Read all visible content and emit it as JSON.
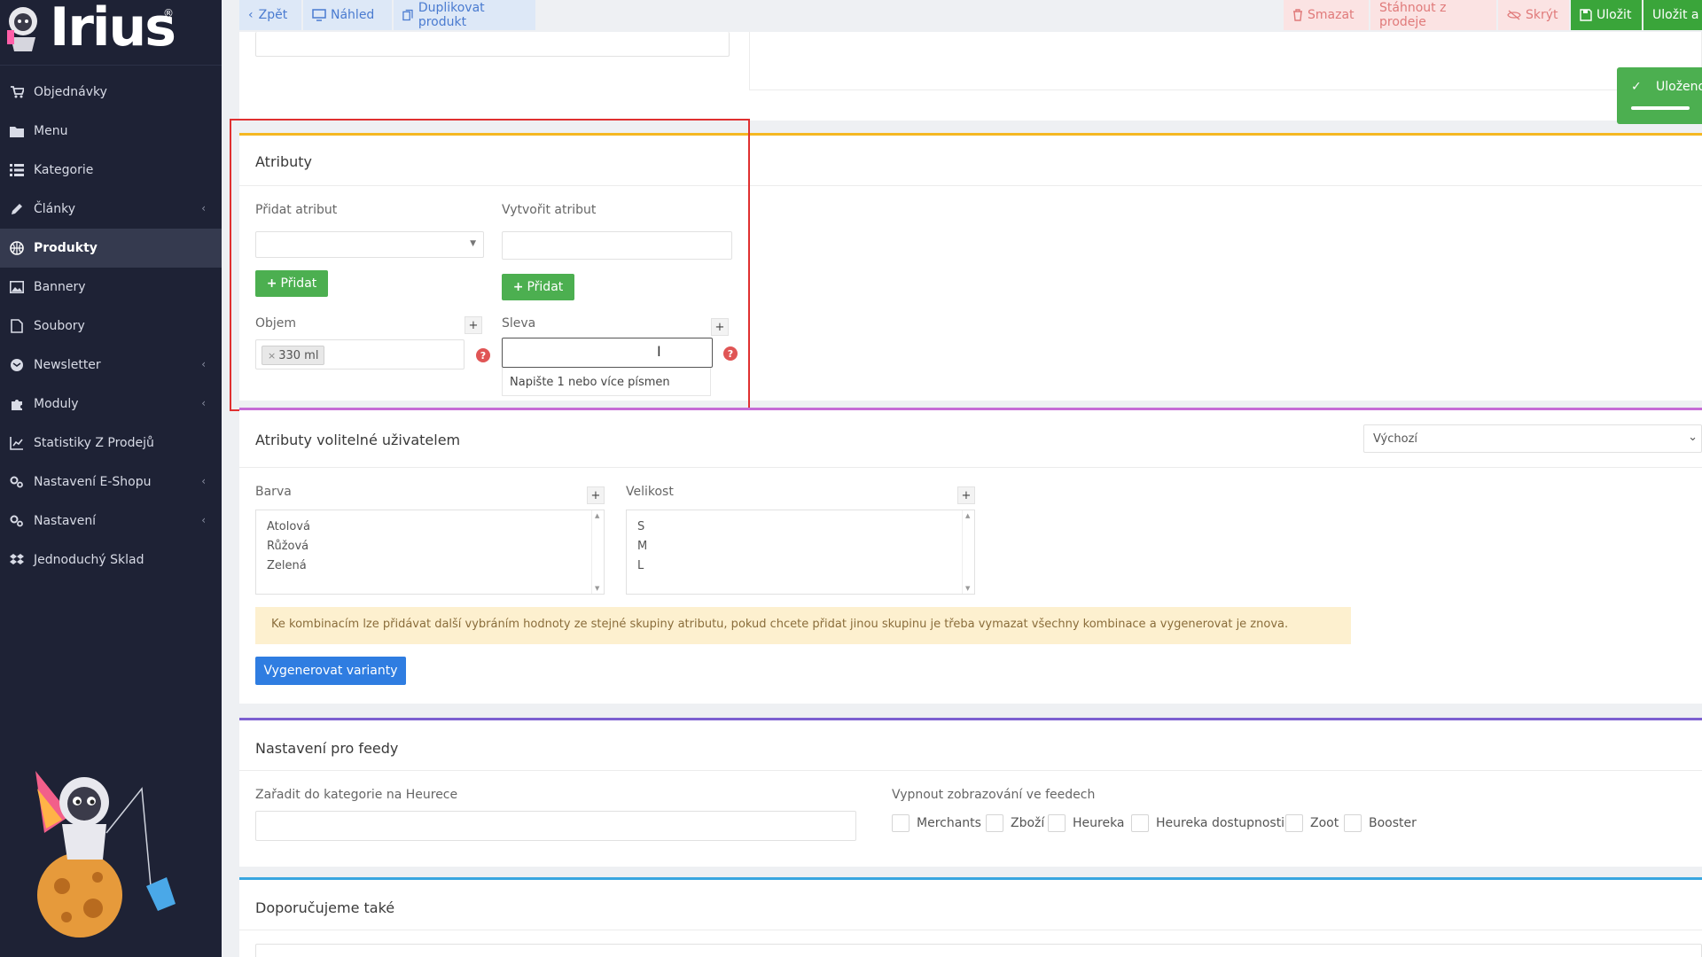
{
  "sidebar": {
    "brand": "Irius",
    "brand_mark": "®",
    "items": [
      {
        "label": "Objednávky",
        "icon": "cart-icon"
      },
      {
        "label": "Menu",
        "icon": "folder-icon"
      },
      {
        "label": "Kategorie",
        "icon": "list-icon"
      },
      {
        "label": "Články",
        "icon": "pencil-icon"
      },
      {
        "label": "Produkty",
        "icon": "basketball-icon"
      },
      {
        "label": "Bannery",
        "icon": "image-icon"
      },
      {
        "label": "Soubory",
        "icon": "file-icon"
      },
      {
        "label": "Newsletter",
        "icon": "email-icon"
      },
      {
        "label": "Moduly",
        "icon": "puzzle-icon"
      },
      {
        "label": "Statistiky Z Prodejů",
        "icon": "chart-icon"
      },
      {
        "label": "Nastavení E-Shopu",
        "icon": "gears-icon"
      },
      {
        "label": "Nastavení",
        "icon": "gears-icon"
      },
      {
        "label": "Jednoduchý Sklad",
        "icon": "dropbox-icon"
      }
    ]
  },
  "toolbar": {
    "back": "Zpět",
    "preview": "Náhled",
    "duplicate": "Duplikovat produkt",
    "delete": "Smazat",
    "withdraw": "Stáhnout z prodeje",
    "hide": "Skrýt",
    "save": "Uložit",
    "save_and": "Uložit a ze"
  },
  "toast": {
    "text": "Uloženo"
  },
  "attributes": {
    "title": "Atributy",
    "add_label": "Přidat atribut",
    "create_label": "Vytvořit atribut",
    "add_button": "Přidat",
    "create_button": "Přidat",
    "volume_label": "Objem",
    "volume_tag_x": "×",
    "volume_tag": "330 ml",
    "discount_label": "Sleva",
    "hint": "Napište 1 nebo více písmen",
    "plus": "+",
    "help": "?"
  },
  "optional": {
    "title": "Atributy volitelné uživatelem",
    "select_value": "Výchozí",
    "color_label": "Barva",
    "colors": [
      "Atolová",
      "Růžová",
      "Zelená"
    ],
    "size_label": "Velikost",
    "sizes": [
      "S",
      "M",
      "L"
    ],
    "notice": "Ke kombinacím lze přidávat další vybráním hodnoty ze stejné skupiny atributu, pokud chcete přidat jinou skupinu je třeba vymazat všechny kombinace a vygenerovat je znova.",
    "generate_button": "Vygenerovat varianty"
  },
  "feeds": {
    "title": "Nastavení pro feedy",
    "category_label": "Zařadit do kategorie na Heurece",
    "disable_label": "Vypnout zobrazování ve feedech",
    "options": [
      "Merchants",
      "Zboží",
      "Heureka",
      "Heureka dostupnosti",
      "Zoot",
      "Booster"
    ]
  },
  "recommend": {
    "title": "Doporučujeme také"
  },
  "colors": {
    "sidebar_bg": "#1e2235",
    "accent_green": "#4caf50",
    "accent_blue": "#2f7de1",
    "highlight_red": "#e03030",
    "stripe_attributes": "#f5b822",
    "stripe_optional": "#c66bd6",
    "stripe_feeds": "#7c5fd0",
    "stripe_recommend": "#38a6e0"
  }
}
